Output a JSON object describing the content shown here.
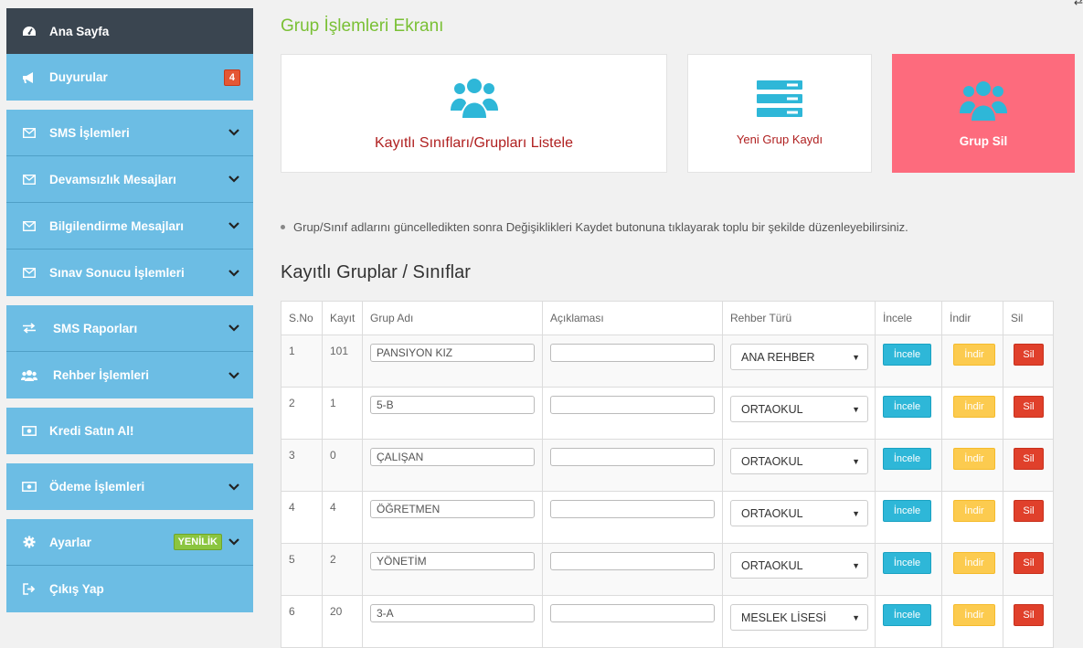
{
  "sidebar": {
    "items": [
      {
        "label": "Ana Sayfa",
        "icon": "dashboard-icon"
      },
      {
        "label": "Duyurular",
        "icon": "megaphone-icon",
        "badge": "4"
      },
      {
        "label": "SMS İşlemleri",
        "icon": "envelope-icon"
      },
      {
        "label": "Devamsızlık Mesajları",
        "icon": "envelope-icon"
      },
      {
        "label": "Bilgilendirme Mesajları",
        "icon": "envelope-icon"
      },
      {
        "label": "Sınav Sonucu İşlemleri",
        "icon": "envelope-icon"
      },
      {
        "label": "SMS Raporları",
        "icon": "exchange-icon"
      },
      {
        "label": "Rehber İşlemleri",
        "icon": "users-icon"
      },
      {
        "label": "Kredi Satın Al!",
        "icon": "money-icon"
      },
      {
        "label": "Ödeme İşlemleri",
        "icon": "money-icon"
      },
      {
        "label": "Ayarlar",
        "icon": "gear-icon",
        "badge": "YENİLİK"
      },
      {
        "label": "Çıkış Yap",
        "icon": "sign-out-icon"
      }
    ]
  },
  "main": {
    "title": "Grup İşlemleri Ekranı",
    "cards": [
      {
        "label": "Kayıtlı Sınıfları/Grupları Listele",
        "icon": "users-icon"
      },
      {
        "label": "Yeni Grup Kaydı",
        "icon": "server-list-icon"
      },
      {
        "label": "Grup Sil",
        "icon": "users-icon"
      }
    ],
    "info_text": "Grup/Sınıf adlarını güncelledikten sonra Değişiklikleri Kaydet butonuna tıklayarak toplu bir şekilde düzenleyebilirsiniz.",
    "section_title": "Kayıtlı Gruplar / Sınıflar"
  },
  "table": {
    "headers": [
      "S.No",
      "Kayıt",
      "Grup Adı",
      "Açıklaması",
      "Rehber Türü",
      "İncele",
      "İndir",
      "Sil"
    ],
    "rows": [
      {
        "sno": "1",
        "kayit": "101",
        "grup": "PANSIYON KIZ",
        "aciklama": "",
        "rehber": "ANA REHBER"
      },
      {
        "sno": "2",
        "kayit": "1",
        "grup": "5-B",
        "aciklama": "",
        "rehber": "ORTAOKUL"
      },
      {
        "sno": "3",
        "kayit": "0",
        "grup": "ÇALIŞAN",
        "aciklama": "",
        "rehber": "ORTAOKUL"
      },
      {
        "sno": "4",
        "kayit": "4",
        "grup": "ÖĞRETMEN",
        "aciklama": "",
        "rehber": "ORTAOKUL"
      },
      {
        "sno": "5",
        "kayit": "2",
        "grup": "YÖNETİM",
        "aciklama": "",
        "rehber": "ORTAOKUL"
      },
      {
        "sno": "6",
        "kayit": "20",
        "grup": "3-A",
        "aciklama": "",
        "rehber": "MESLEK LİSESİ"
      }
    ],
    "buttons": {
      "incele": "İncele",
      "indir": "İndir",
      "sil": "Sil"
    }
  },
  "colors": {
    "sidebar": "#6cbde4",
    "sidebar_dark": "#3a4550",
    "title_green": "#7ac035",
    "card_pink": "#fd6b7d",
    "icon_blue": "#2eb7d8"
  }
}
